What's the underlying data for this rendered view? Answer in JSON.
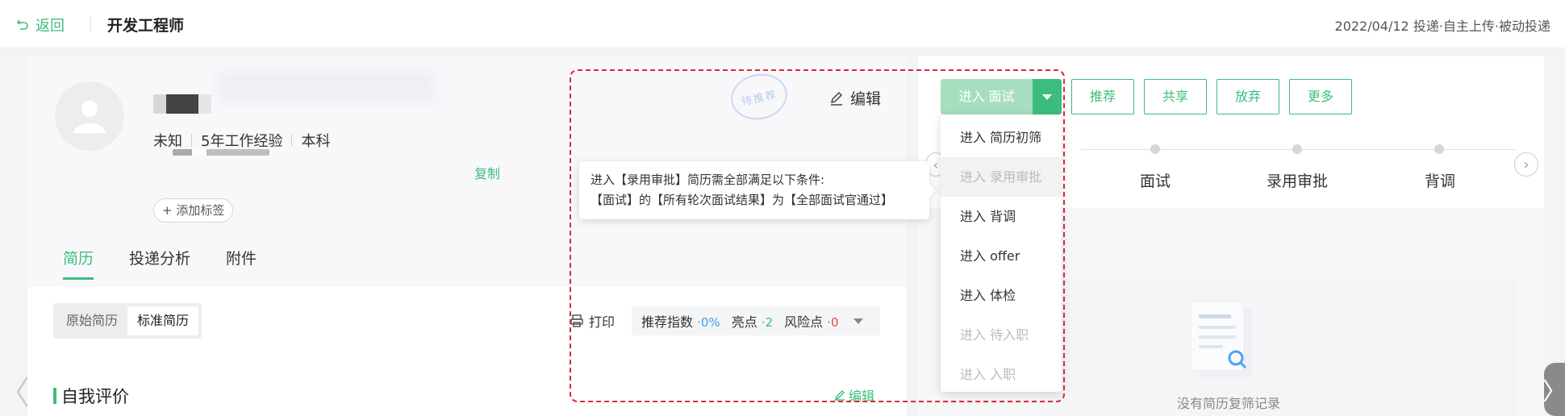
{
  "topbar": {
    "back_label": "返回",
    "job_title": "开发工程师",
    "meta": "2022/04/12 投递·自主上传·被动投递"
  },
  "profile": {
    "gender": "未知",
    "experience": "5年工作经验",
    "education": "本科",
    "copy_fragment": "复制",
    "add_tag": "+ 添加标签",
    "stamp_text": "待推荐",
    "edit_label": "编辑"
  },
  "tabs": [
    {
      "label": "简历",
      "active": true
    },
    {
      "label": "投递分析",
      "active": false
    },
    {
      "label": "附件",
      "active": false
    }
  ],
  "resume": {
    "original": "原始简历",
    "standard": "标准简历",
    "print": "打印",
    "score_label": "推荐指数",
    "score_value": "·0%",
    "highlight_label": "亮点",
    "highlight_value": "·2",
    "risk_label": "风险点",
    "risk_value": "·0",
    "section_title": "自我评价",
    "section_edit": "编辑"
  },
  "tooltip": {
    "line1": "进入【录用审批】简历需全部满足以下条件:",
    "line2": "【面试】的【所有轮次面试结果】为【全部面试官通过】"
  },
  "actions": {
    "primary": "进入 面试",
    "buttons": [
      "推荐",
      "共享",
      "放弃",
      "更多"
    ]
  },
  "dropdown": [
    {
      "label": "进入 简历初筛",
      "disabled": false
    },
    {
      "label": "进入 录用审批",
      "disabled": true
    },
    {
      "label": "进入 背调",
      "disabled": false
    },
    {
      "label": "进入 offer",
      "disabled": false
    },
    {
      "label": "进入 体检",
      "disabled": false
    },
    {
      "label": "进入 待入职",
      "disabled": true
    },
    {
      "label": "进入 入职",
      "disabled": true
    }
  ],
  "stages": [
    "面试",
    "录用审批",
    "背调"
  ],
  "empty": {
    "text": "没有简历复筛记录"
  },
  "colors": {
    "accent": "#3dbd7d",
    "highlight_border": "#d8283a",
    "score_blue": "#3a9ef0",
    "risk_red": "#e84a4a"
  }
}
